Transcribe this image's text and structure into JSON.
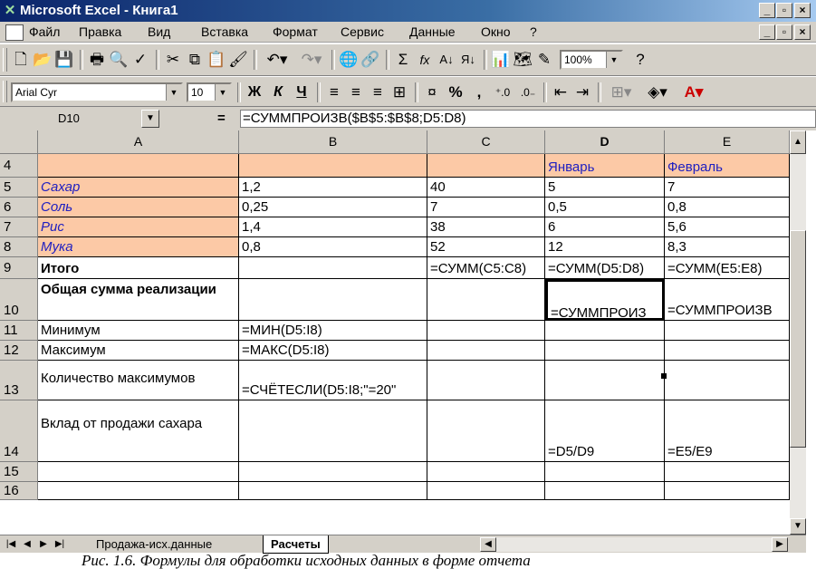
{
  "window": {
    "title": "Microsoft Excel - Книга1"
  },
  "menu": {
    "items": [
      {
        "label": "Файл"
      },
      {
        "label": "Правка"
      },
      {
        "label": "Вид"
      },
      {
        "label": "Вставка"
      },
      {
        "label": "Формат"
      },
      {
        "label": "Сервис"
      },
      {
        "label": "Данные"
      },
      {
        "label": "Окно"
      },
      {
        "label": "?"
      }
    ]
  },
  "toolbar": {
    "zoom": "100%",
    "font_name": "Arial Cyr",
    "font_size": "10",
    "bold": "Ж",
    "italic": "К",
    "underline": "Ч",
    "sum": "Σ",
    "fx": "fx",
    "percent": "%",
    "comma": ","
  },
  "formula_bar": {
    "name_box": "D10",
    "equals": "=",
    "formula": "=СУММПРОИЗВ($B$5:$B$8;D5:D8)"
  },
  "columns": [
    "A",
    "B",
    "C",
    "D",
    "E"
  ],
  "rows": [
    {
      "num": "4",
      "cells": [
        "",
        "",
        "",
        "Январь",
        "Февраль"
      ]
    },
    {
      "num": "5",
      "cells": [
        "Сахар",
        "1,2",
        "40",
        "5",
        "7"
      ]
    },
    {
      "num": "6",
      "cells": [
        "Соль",
        "0,25",
        "7",
        "0,5",
        "0,8"
      ]
    },
    {
      "num": "7",
      "cells": [
        "Рис",
        "1,4",
        "38",
        "6",
        "5,6"
      ]
    },
    {
      "num": "8",
      "cells": [
        "Мука",
        "0,8",
        "52",
        "12",
        "8,3"
      ]
    },
    {
      "num": "9",
      "cells": [
        "Итого",
        "",
        "=СУММ(C5:C8)",
        "=СУММ(D5:D8)",
        "=СУММ(E5:E8)"
      ]
    },
    {
      "num": "10",
      "cells": [
        "Общая сумма реализации",
        "",
        "",
        "=СУММПРОИЗ",
        "=СУММПРОИЗВ"
      ]
    },
    {
      "num": "11",
      "cells": [
        "Минимум",
        "=МИН(D5:I8)",
        "",
        "",
        ""
      ]
    },
    {
      "num": "12",
      "cells": [
        "Максимум",
        "=МАКС(D5:I8)",
        "",
        "",
        ""
      ]
    },
    {
      "num": "13",
      "cells": [
        "Количество максимумов",
        "=СЧЁТЕСЛИ(D5:I8;\"=20\"",
        "",
        "",
        ""
      ]
    },
    {
      "num": "14",
      "cells": [
        "Вклад от продажи сахара",
        "",
        "",
        "=D5/D9",
        "=E5/E9"
      ]
    },
    {
      "num": "15",
      "cells": [
        "",
        "",
        "",
        "",
        ""
      ]
    },
    {
      "num": "16",
      "cells": [
        "",
        "",
        "",
        "",
        ""
      ]
    }
  ],
  "sheets": [
    {
      "label": "Продажа-исх.данные",
      "active": false
    },
    {
      "label": "Расчеты",
      "active": true
    }
  ],
  "caption": "Рис. 1.6. Формулы для обработки исходных данных в форме отчета",
  "colors": {
    "header_fill": "#fcc9a6",
    "label_blue": "#2020c0",
    "title_bar": "#0a246a"
  }
}
